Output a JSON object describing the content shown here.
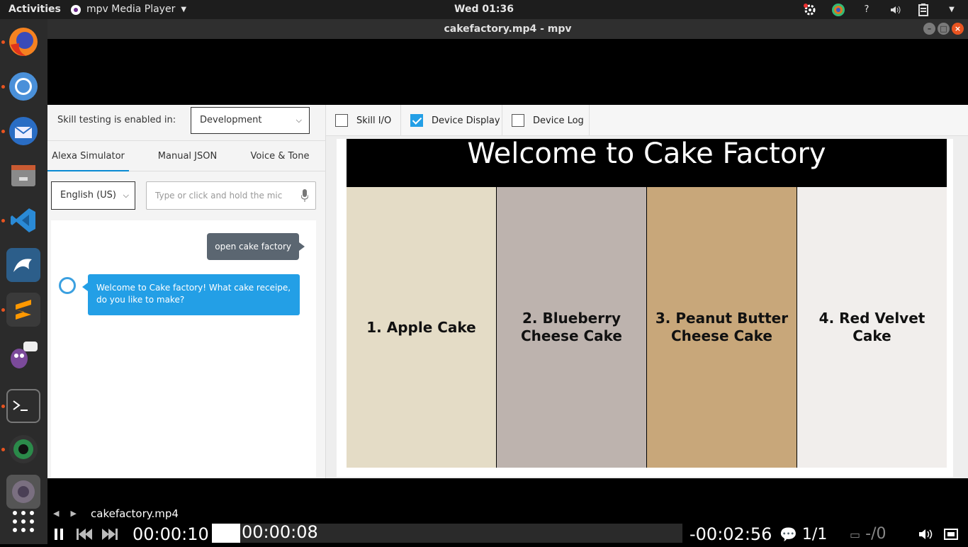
{
  "topbar": {
    "activities": "Activities",
    "app_menu": "mpv Media Player",
    "clock": "Wed 01:36",
    "help": "?"
  },
  "dock": {
    "apps": [
      "firefox-icon",
      "chromium-icon",
      "thunderbird-icon",
      "files-icon",
      "vscode-icon",
      "mysql-workbench-icon",
      "sublime-text-icon",
      "pidgin-icon",
      "terminal-icon",
      "webcam-icon",
      "mpv-icon"
    ],
    "show_apps": "show-applications-icon"
  },
  "window": {
    "title": "cakefactory.mp4 - mpv"
  },
  "simulator": {
    "skill_testing_label": "Skill testing is enabled in:",
    "environment": "Development",
    "tabs": [
      "Alexa Simulator",
      "Manual JSON",
      "Voice & Tone"
    ],
    "language": "English (US)",
    "utterance_placeholder": "Type or click and hold the mic",
    "user_message": "open cake factory",
    "alexa_message": "Welcome to Cake factory! What cake receipe, do you like to make?"
  },
  "checks": [
    {
      "label": "Skill I/O",
      "checked": false
    },
    {
      "label": "Device Display",
      "checked": true
    },
    {
      "label": "Device Log",
      "checked": false
    }
  ],
  "device_display": {
    "title": "Welcome to Cake Factory",
    "items": [
      "1. Apple Cake",
      "2. Blueberry Cheese Cake",
      "3. Peanut Butter Cheese Cake",
      "4. Red Velvet Cake"
    ],
    "panel_colors": [
      "#e4dcc6",
      "#bdb3ae",
      "#c8a77a",
      "#f1eeec"
    ]
  },
  "player": {
    "filename": "cakefactory.mp4",
    "elapsed": "00:00:10",
    "cache": "00:00:08",
    "remaining": "-00:02:56",
    "playlist": "1/1",
    "subtitles": "-/0",
    "progress": 0.06
  }
}
